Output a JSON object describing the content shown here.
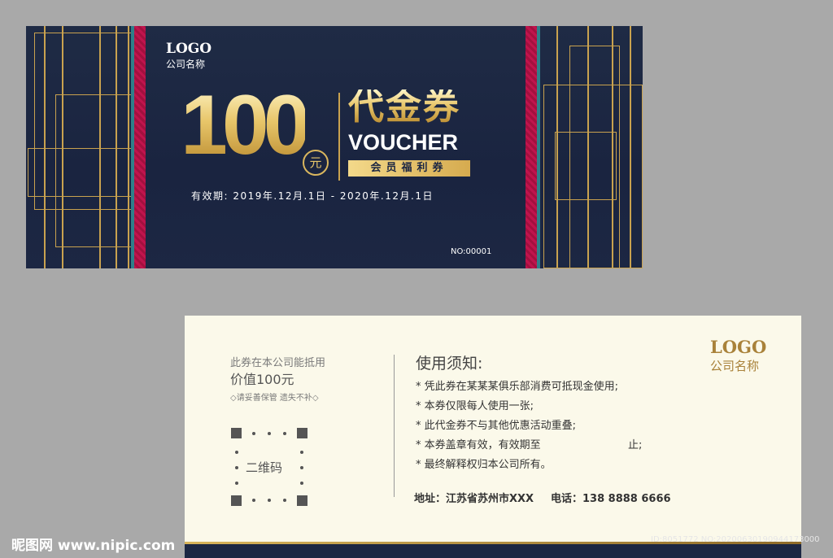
{
  "front": {
    "logo": "LOGO",
    "company": "公司名称",
    "amount": "100",
    "currency": "元",
    "title_cn": "代金券",
    "title_en": "VOUCHER",
    "member_tag": "会员福利券",
    "validity": "有效期: 2019年.12月.1日 - 2020年.12月.1日",
    "serial": "NO:00001"
  },
  "back": {
    "deduct_line1": "此券在本公司能抵用",
    "deduct_line2": "价值100元",
    "keep_note": "◇请妥善保管 遗失不补◇",
    "qr_label": "二维码",
    "rules_title": "使用须知:",
    "rules": [
      "* 凭此券在某某某俱乐部消费可抵现金使用;",
      "* 本券仅限每人使用一张;",
      "* 此代金券不与其他优惠活动重叠;",
      "* 本券盖章有效，有效期至",
      "* 最终解释权归本公司所有。"
    ],
    "rule_4_end": "止;",
    "address": "地址：江苏省苏州市XXX",
    "phone": "电话：138 8888 6666",
    "logo": "LOGO",
    "company": "公司名称"
  },
  "watermark": {
    "left": "昵图网 www.nipic.com",
    "right": "ID:8051772 NO:20200630190944173000"
  },
  "colors": {
    "navy": "#1c2743",
    "gold": "#c9a24f",
    "crimson": "#c0144d",
    "cream": "#fbf9ea",
    "background": "#a9a9a9"
  }
}
